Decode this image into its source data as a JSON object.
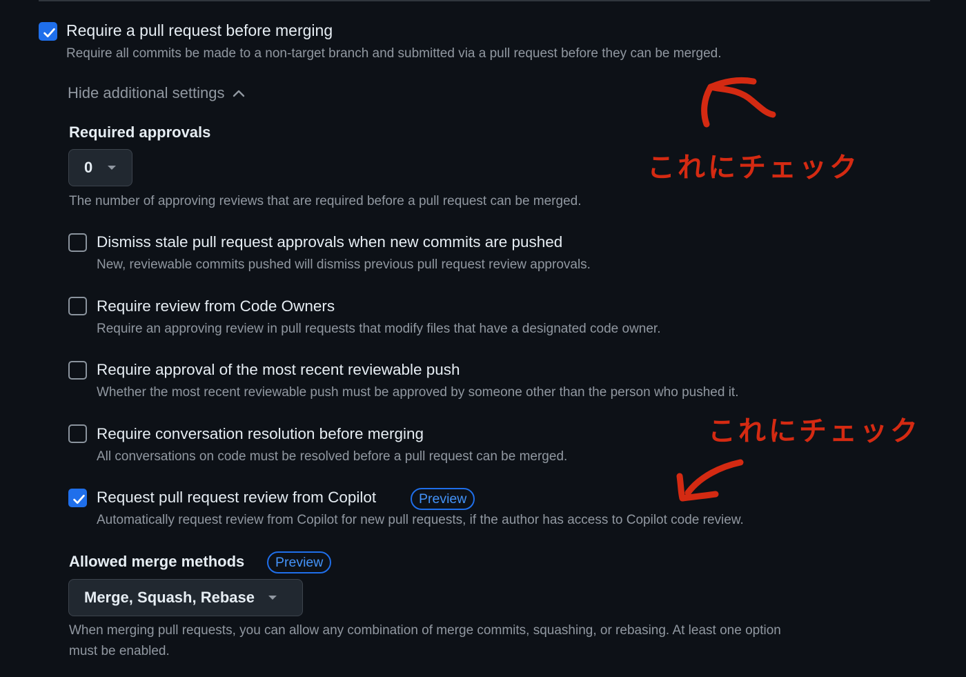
{
  "main_rule": {
    "checked": true,
    "title": "Require a pull request before merging",
    "description": "Require all commits be made to a non-target branch and submitted via a pull request before they can be merged."
  },
  "settings_toggle": {
    "label": "Hide additional settings",
    "icon": "chevron-up-icon"
  },
  "required_approvals": {
    "title": "Required approvals",
    "selected_value": "0",
    "description": "The number of approving reviews that are required before a pull request can be merged."
  },
  "options": [
    {
      "checked": false,
      "title": "Dismiss stale pull request approvals when new commits are pushed",
      "description": "New, reviewable commits pushed will dismiss previous pull request review approvals."
    },
    {
      "checked": false,
      "title": "Require review from Code Owners",
      "description": "Require an approving review in pull requests that modify files that have a designated code owner."
    },
    {
      "checked": false,
      "title": "Require approval of the most recent reviewable push",
      "description": "Whether the most recent reviewable push must be approved by someone other than the person who pushed it."
    },
    {
      "checked": false,
      "title": "Require conversation resolution before merging",
      "description": "All conversations on code must be resolved before a pull request can be merged."
    },
    {
      "checked": true,
      "title": "Request pull request review from Copilot",
      "badge": "Preview",
      "description": "Automatically request review from Copilot for new pull requests, if the author has access to Copilot code review."
    }
  ],
  "merge_methods": {
    "title": "Allowed merge methods",
    "badge": "Preview",
    "selected_value": "Merge, Squash, Rebase",
    "description_line1": "When merging pull requests, you can allow any combination of merge commits, squashing, or rebasing. At least one option",
    "description_line2": "must be enabled."
  },
  "annotations": [
    {
      "text": "これにチェック",
      "color": "#d42a12"
    },
    {
      "text": "これにチェック",
      "color": "#d42a12"
    }
  ],
  "colors": {
    "background": "#0d1117",
    "accent": "#1f6feb",
    "text_primary": "#e6edf3",
    "text_muted": "#9198a1",
    "annotation": "#d42a12"
  }
}
